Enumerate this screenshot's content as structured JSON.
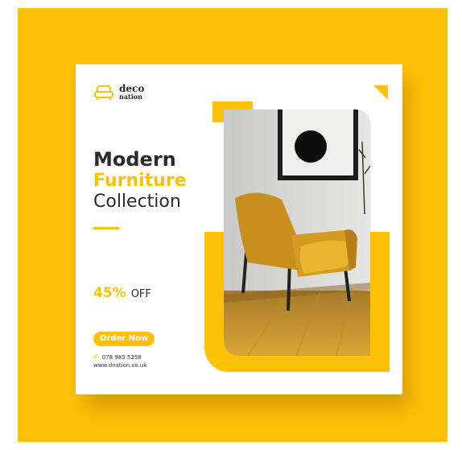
{
  "brand": {
    "name_top": "deco",
    "name_bottom": "nation"
  },
  "headline": {
    "line1": "Modern",
    "line2": "Furniture",
    "line3": "Collection"
  },
  "offer": {
    "percent": "45%",
    "label": "OFF"
  },
  "cta": {
    "label": "Order Now"
  },
  "contact": {
    "phone": "078 985 5258",
    "website": "www.dnation.co.uk"
  },
  "icons": {
    "logo": "sofa-icon",
    "phone": "phone-icon"
  },
  "colors": {
    "accent": "#ffc107",
    "text": "#2a2a2a",
    "background": "#ffffff"
  }
}
